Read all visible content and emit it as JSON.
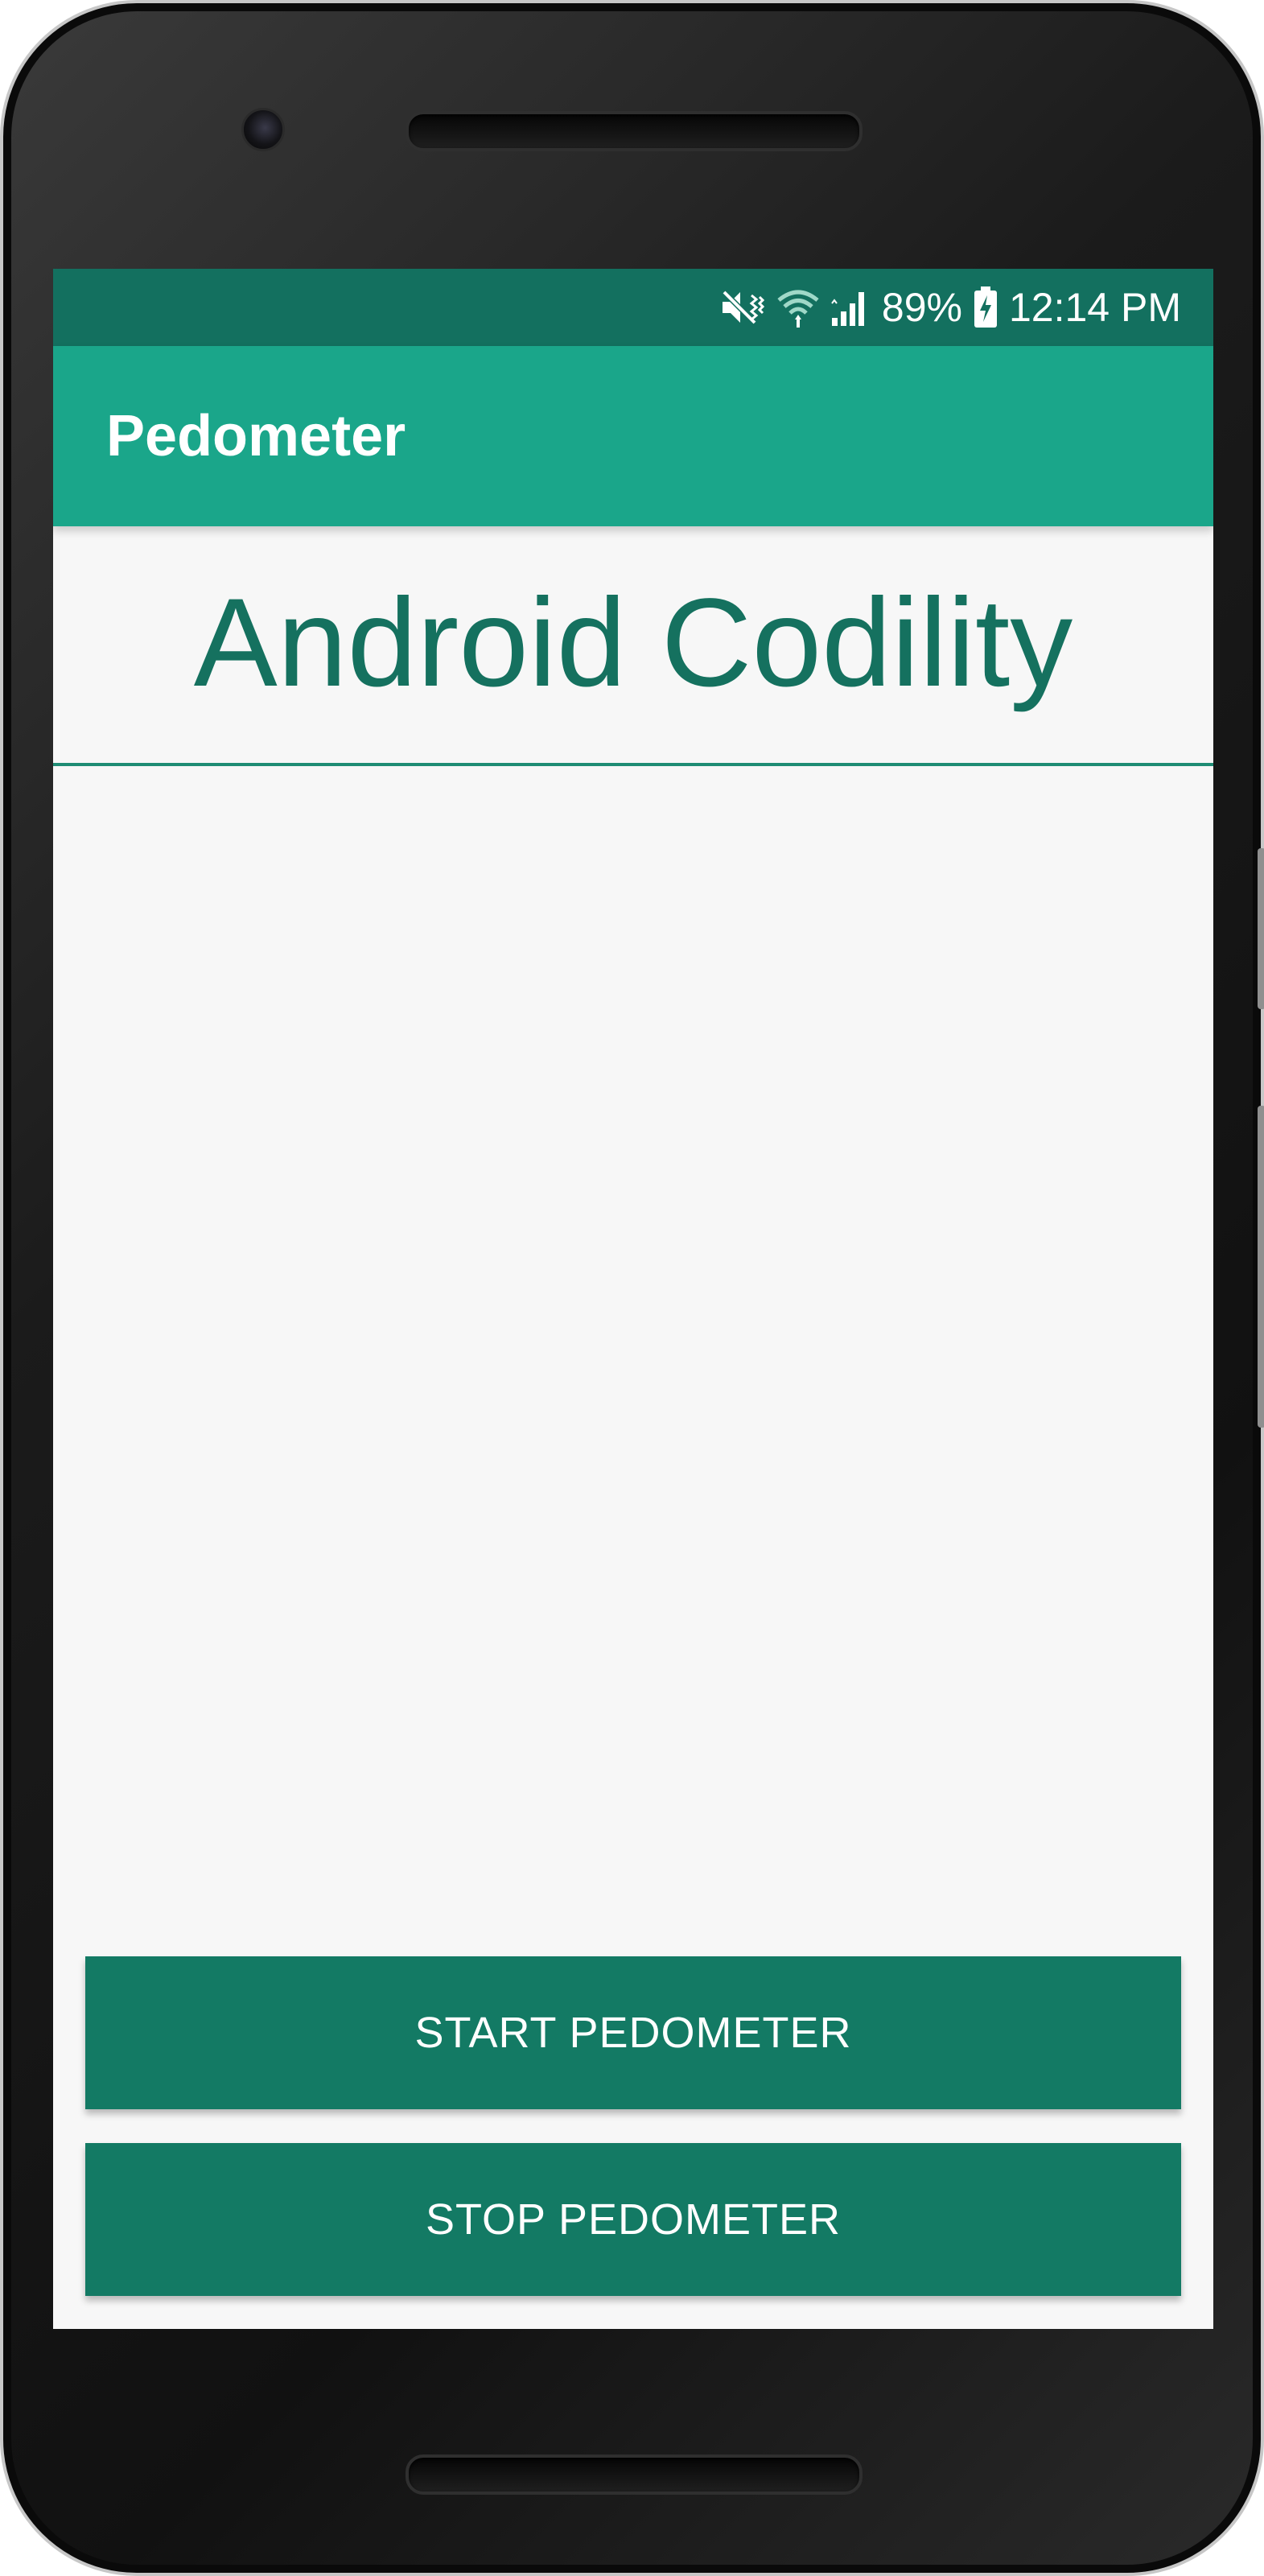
{
  "status_bar": {
    "battery_percent": "89%",
    "time": "12:14 PM",
    "icons": [
      "mute-vibrate-icon",
      "wifi-icon",
      "signal-icon",
      "battery-charging-icon"
    ],
    "color": "#13705f"
  },
  "app_bar": {
    "title": "Pedometer",
    "color": "#1aa68a"
  },
  "main": {
    "heading": "Android Codility",
    "heading_color": "#15715f",
    "background": "#f7f7f7"
  },
  "buttons": {
    "start_label": "START PEDOMETER",
    "stop_label": "STOP PEDOMETER",
    "color": "#137a64"
  }
}
